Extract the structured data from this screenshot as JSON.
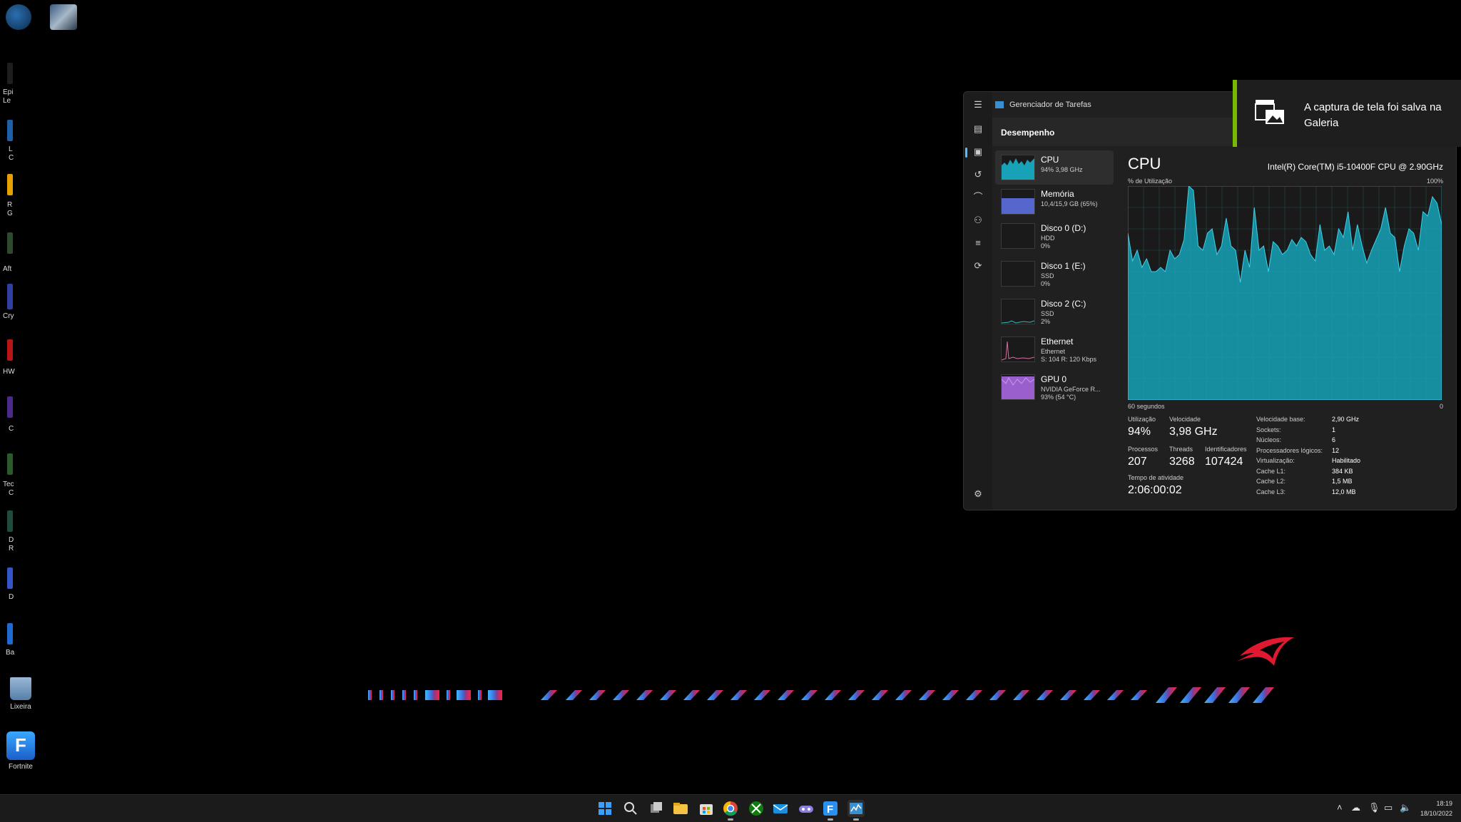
{
  "desktop": {
    "icons": [
      {
        "label": "Lixeira"
      },
      {
        "label": "Fortnite"
      }
    ],
    "edge_labels": [
      "Epi",
      "Le",
      "L",
      "C",
      "R",
      "G",
      "Aft",
      "Cry",
      "HW",
      "C",
      "Tec",
      "C",
      "D",
      "R",
      "D",
      "Ba"
    ]
  },
  "task_manager": {
    "title": "Gerenciador de Tarefas",
    "section": "Desempenho",
    "sidebar": [
      {
        "name": "CPU",
        "line2": "94% 3,98 GHz",
        "line3": ""
      },
      {
        "name": "Memória",
        "line2": "10,4/15,9 GB (65%)",
        "line3": ""
      },
      {
        "name": "Disco 0 (D:)",
        "line2": "HDD",
        "line3": "0%"
      },
      {
        "name": "Disco 1 (E:)",
        "line2": "SSD",
        "line3": "0%"
      },
      {
        "name": "Disco 2 (C:)",
        "line2": "SSD",
        "line3": "2%"
      },
      {
        "name": "Ethernet",
        "line2": "Ethernet",
        "line3": "S: 104 R: 120 Kbps"
      },
      {
        "name": "GPU 0",
        "line2": "NVIDIA GeForce R...",
        "line3": "93% (54 °C)"
      }
    ],
    "cpu": {
      "title": "CPU",
      "model": "Intel(R) Core(TM) i5-10400F CPU @ 2.90GHz",
      "util_label": "% de Utilização",
      "max_label": "100%",
      "seconds_label": "60 segundos",
      "zero_label": "0",
      "stats": {
        "util_label": "Utilização",
        "util_value": "94%",
        "speed_label": "Velocidade",
        "speed_value": "3,98 GHz",
        "proc_label": "Processos",
        "proc_value": "207",
        "threads_label": "Threads",
        "threads_value": "3268",
        "handles_label": "Identificadores",
        "handles_value": "107424",
        "uptime_label": "Tempo de atividade",
        "uptime_value": "2:06:00:02"
      },
      "specs": [
        {
          "k": "Velocidade base:",
          "v": "2,90 GHz"
        },
        {
          "k": "Sockets:",
          "v": "1"
        },
        {
          "k": "Núcleos:",
          "v": "6"
        },
        {
          "k": "Processadores lógicos:",
          "v": "12"
        },
        {
          "k": "Virtualização:",
          "v": "Habilitado"
        },
        {
          "k": "Cache L1:",
          "v": "384 KB"
        },
        {
          "k": "Cache L2:",
          "v": "1,5 MB"
        },
        {
          "k": "Cache L3:",
          "v": "12,0 MB"
        }
      ],
      "graph_color": "#17a2b8",
      "history_percent": [
        78,
        65,
        70,
        62,
        66,
        60,
        60,
        62,
        60,
        70,
        66,
        68,
        75,
        100,
        98,
        72,
        70,
        78,
        80,
        68,
        72,
        85,
        72,
        70,
        55,
        70,
        62,
        90,
        70,
        72,
        60,
        74,
        72,
        68,
        70,
        75,
        72,
        76,
        74,
        68,
        65,
        82,
        70,
        72,
        68,
        80,
        76,
        88,
        70,
        82,
        72,
        64,
        70,
        75,
        80,
        90,
        78,
        76,
        60,
        72,
        80,
        78,
        70,
        88,
        86,
        95,
        92,
        82
      ]
    }
  },
  "toast": {
    "message": "A captura de tela foi salva na Galeria",
    "accent": "#76b900"
  },
  "taskbar": {
    "clock_time": "18:19",
    "clock_date": "18/10/2022"
  }
}
